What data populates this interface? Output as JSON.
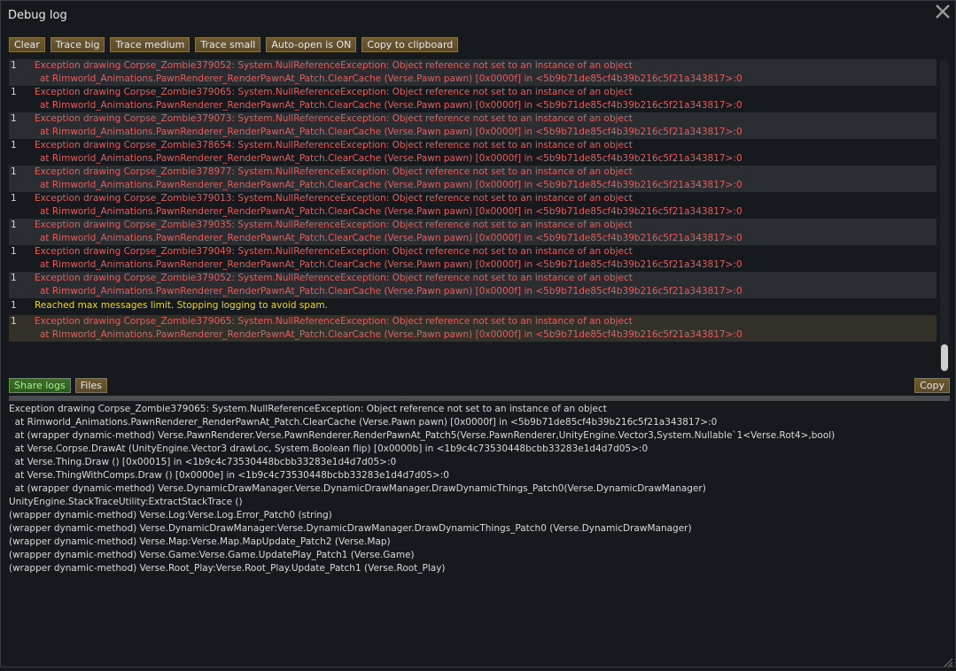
{
  "window": {
    "title": "Debug log",
    "close_icon": "close-icon",
    "resize_icon": "resize-grip-icon"
  },
  "toolbar": {
    "buttons": [
      "Clear",
      "Trace big",
      "Trace medium",
      "Trace small",
      "Auto-open is ON",
      "Copy to clipboard"
    ]
  },
  "log": {
    "entries": [
      {
        "count": "1",
        "type": "error",
        "lines": [
          "Exception drawing Corpse_Zombie379052: System.NullReferenceException: Object reference not set to an instance of an object",
          "at Rimworld_Animations.PawnRenderer_RenderPawnAt_Patch.ClearCache (Verse.Pawn pawn) [0x0000f] in <5b9b71de85cf4b39b216c5f21a343817>:0"
        ]
      },
      {
        "count": "1",
        "type": "error",
        "lines": [
          "Exception drawing Corpse_Zombie379065: System.NullReferenceException: Object reference not set to an instance of an object",
          "at Rimworld_Animations.PawnRenderer_RenderPawnAt_Patch.ClearCache (Verse.Pawn pawn) [0x0000f] in <5b9b71de85cf4b39b216c5f21a343817>:0"
        ]
      },
      {
        "count": "1",
        "type": "error",
        "lines": [
          "Exception drawing Corpse_Zombie379073: System.NullReferenceException: Object reference not set to an instance of an object",
          "at Rimworld_Animations.PawnRenderer_RenderPawnAt_Patch.ClearCache (Verse.Pawn pawn) [0x0000f] in <5b9b71de85cf4b39b216c5f21a343817>:0"
        ]
      },
      {
        "count": "1",
        "type": "error",
        "lines": [
          "Exception drawing Corpse_Zombie378654: System.NullReferenceException: Object reference not set to an instance of an object",
          "at Rimworld_Animations.PawnRenderer_RenderPawnAt_Patch.ClearCache (Verse.Pawn pawn) [0x0000f] in <5b9b71de85cf4b39b216c5f21a343817>:0"
        ]
      },
      {
        "count": "1",
        "type": "error",
        "lines": [
          "Exception drawing Corpse_Zombie378977: System.NullReferenceException: Object reference not set to an instance of an object",
          "at Rimworld_Animations.PawnRenderer_RenderPawnAt_Patch.ClearCache (Verse.Pawn pawn) [0x0000f] in <5b9b71de85cf4b39b216c5f21a343817>:0"
        ]
      },
      {
        "count": "1",
        "type": "error",
        "lines": [
          "Exception drawing Corpse_Zombie379013: System.NullReferenceException: Object reference not set to an instance of an object",
          "at Rimworld_Animations.PawnRenderer_RenderPawnAt_Patch.ClearCache (Verse.Pawn pawn) [0x0000f] in <5b9b71de85cf4b39b216c5f21a343817>:0"
        ]
      },
      {
        "count": "1",
        "type": "error",
        "lines": [
          "Exception drawing Corpse_Zombie379035: System.NullReferenceException: Object reference not set to an instance of an object",
          "at Rimworld_Animations.PawnRenderer_RenderPawnAt_Patch.ClearCache (Verse.Pawn pawn) [0x0000f] in <5b9b71de85cf4b39b216c5f21a343817>:0"
        ]
      },
      {
        "count": "1",
        "type": "error",
        "lines": [
          "Exception drawing Corpse_Zombie379049: System.NullReferenceException: Object reference not set to an instance of an object",
          "at Rimworld_Animations.PawnRenderer_RenderPawnAt_Patch.ClearCache (Verse.Pawn pawn) [0x0000f] in <5b9b71de85cf4b39b216c5f21a343817>:0"
        ]
      },
      {
        "count": "1",
        "type": "error",
        "lines": [
          "Exception drawing Corpse_Zombie379052: System.NullReferenceException: Object reference not set to an instance of an object",
          "at Rimworld_Animations.PawnRenderer_RenderPawnAt_Patch.ClearCache (Verse.Pawn pawn) [0x0000f] in <5b9b71de85cf4b39b216c5f21a343817>:0"
        ]
      },
      {
        "count": "1",
        "type": "warning",
        "lines": [
          "Reached max messages limit. Stopping logging to avoid spam."
        ]
      },
      {
        "count": "1",
        "type": "error",
        "selected": true,
        "lines": [
          "Exception drawing Corpse_Zombie379065: System.NullReferenceException: Object reference not set to an instance of an object",
          "at Rimworld_Animations.PawnRenderer_RenderPawnAt_Patch.ClearCache (Verse.Pawn pawn) [0x0000f] in <5b9b71de85cf4b39b216c5f21a343817>:0"
        ]
      }
    ]
  },
  "bottom": {
    "share_logs": "Share logs",
    "files": "Files",
    "copy": "Copy"
  },
  "details": {
    "lines": [
      "Exception drawing Corpse_Zombie379065: System.NullReferenceException: Object reference not set to an instance of an object",
      "  at Rimworld_Animations.PawnRenderer_RenderPawnAt_Patch.ClearCache (Verse.Pawn pawn) [0x0000f] in <5b9b71de85cf4b39b216c5f21a343817>:0",
      "  at (wrapper dynamic-method) Verse.PawnRenderer.Verse.PawnRenderer.RenderPawnAt_Patch5(Verse.PawnRenderer,UnityEngine.Vector3,System.Nullable`1<Verse.Rot4>,bool)",
      "  at Verse.Corpse.DrawAt (UnityEngine.Vector3 drawLoc, System.Boolean flip) [0x0000b] in <1b9c4c73530448bcbb33283e1d4d7d05>:0",
      "  at Verse.Thing.Draw () [0x00015] in <1b9c4c73530448bcbb33283e1d4d7d05>:0",
      "  at Verse.ThingWithComps.Draw () [0x0000e] in <1b9c4c73530448bcbb33283e1d4d7d05>:0",
      "  at (wrapper dynamic-method) Verse.DynamicDrawManager.Verse.DynamicDrawManager.DrawDynamicThings_Patch0(Verse.DynamicDrawManager)",
      "UnityEngine.StackTraceUtility:ExtractStackTrace ()",
      "(wrapper dynamic-method) Verse.Log:Verse.Log.Error_Patch0 (string)",
      "(wrapper dynamic-method) Verse.DynamicDrawManager:Verse.DynamicDrawManager.DrawDynamicThings_Patch0 (Verse.DynamicDrawManager)",
      "(wrapper dynamic-method) Verse.Map:Verse.Map.MapUpdate_Patch2 (Verse.Map)",
      "(wrapper dynamic-method) Verse.Game:Verse.Game.UpdatePlay_Patch1 (Verse.Game)",
      "(wrapper dynamic-method) Verse.Root_Play:Verse.Root_Play.Update_Patch1 (Verse.Root_Play)"
    ]
  },
  "colors": {
    "error": "#e06060",
    "warning": "#e8d63a",
    "button": "#6e5a33",
    "button_active": "#3f6e2c"
  }
}
